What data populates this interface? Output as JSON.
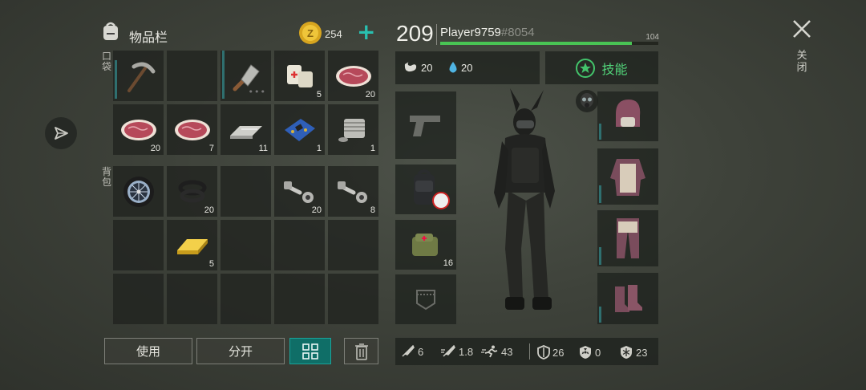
{
  "inventory": {
    "title": "物品栏",
    "coins": "254",
    "pocket_label": "口袋",
    "backpack_label": "背包",
    "pocket_items": [
      {
        "icon": "pickaxe-icon",
        "count": ""
      },
      {
        "icon": "",
        "count": ""
      },
      {
        "icon": "cleaver-icon",
        "count": ""
      },
      {
        "icon": "bandage-icon",
        "count": "5"
      },
      {
        "icon": "raw-meat-icon",
        "count": "20"
      },
      {
        "icon": "raw-meat-icon",
        "count": "20"
      },
      {
        "icon": "raw-meat-icon",
        "count": "7"
      },
      {
        "icon": "scrap-metal-icon",
        "count": "11"
      },
      {
        "icon": "circuit-board-icon",
        "count": "1"
      },
      {
        "icon": "engine-cylinder-icon",
        "count": "1"
      }
    ],
    "backpack_items": [
      {
        "icon": "wheel-icon",
        "count": ""
      },
      {
        "icon": "rubber-rings-icon",
        "count": "20"
      },
      {
        "icon": "",
        "count": ""
      },
      {
        "icon": "bolts-icon",
        "count": "20"
      },
      {
        "icon": "bolts-icon",
        "count": "8"
      },
      {
        "icon": "",
        "count": ""
      },
      {
        "icon": "gold-bar-icon",
        "count": "5"
      },
      {
        "icon": "",
        "count": ""
      },
      {
        "icon": "",
        "count": ""
      },
      {
        "icon": "",
        "count": ""
      },
      {
        "icon": "",
        "count": ""
      },
      {
        "icon": "",
        "count": ""
      },
      {
        "icon": "",
        "count": ""
      },
      {
        "icon": "",
        "count": ""
      },
      {
        "icon": "",
        "count": ""
      }
    ],
    "buttons": {
      "use": "使用",
      "split": "分开"
    }
  },
  "player": {
    "level": "209",
    "name": "Player9759",
    "id": "#8054",
    "xp_fraction": 0.88,
    "xp_value": "104",
    "hunger": "20",
    "thirst": "20",
    "skills_label": "技能"
  },
  "equipment": {
    "bag_count": "16"
  },
  "stats": {
    "melee": "6",
    "attack_speed": "1.8",
    "speed": "43",
    "armor": "26",
    "radiation": "0",
    "cold": "23"
  },
  "close_label": "关闭",
  "colors": {
    "accent": "#1aa39a",
    "xp_bar": "#49c454",
    "meat": "#b6495a"
  }
}
